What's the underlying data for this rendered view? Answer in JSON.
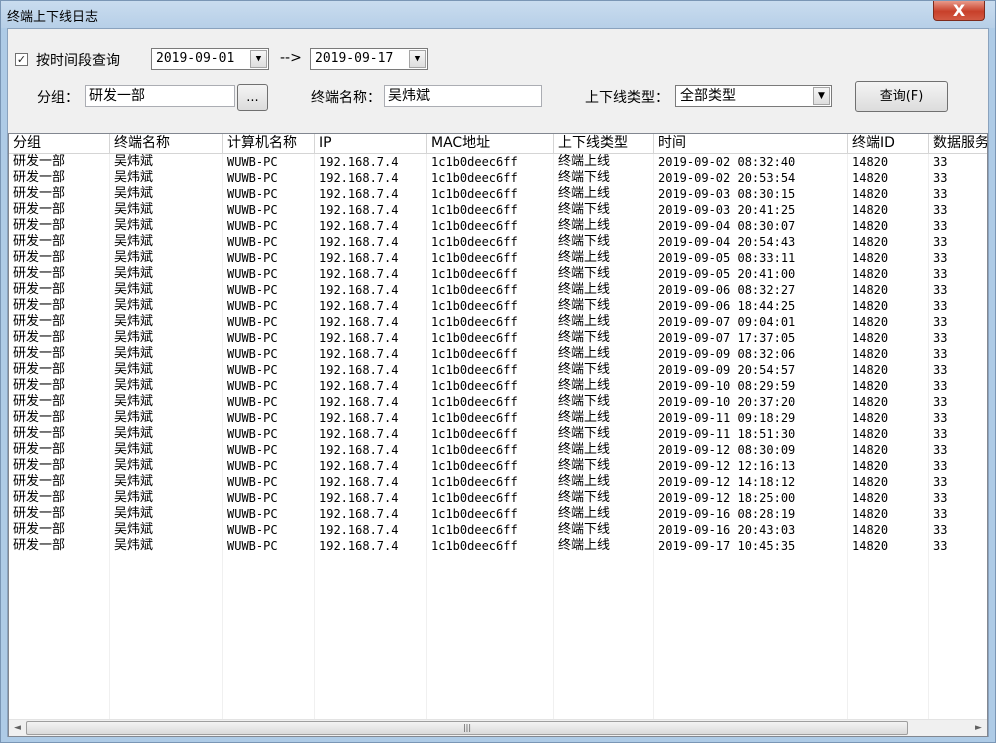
{
  "window": {
    "title": "终端上下线日志",
    "close_glyph": "X"
  },
  "filter": {
    "checkbox_label": "按时间段查询",
    "checkbox_mark": "✓",
    "date_from": "2019-09-01",
    "arrow_text": "-->",
    "date_to": "2019-09-17",
    "group_label": "分组：",
    "group_value": "研发一部",
    "browse_label": "...",
    "terminal_label": "终端名称：",
    "terminal_value": "吴炜斌",
    "type_label": "上下线类型：",
    "type_value": "全部类型",
    "query_button": "查询(F)"
  },
  "columns": [
    "分组",
    "终端名称",
    "计算机名称",
    "IP",
    "MAC地址",
    "上下线类型",
    "时间",
    "终端ID",
    "数据服务"
  ],
  "rows": [
    [
      "研发一部",
      "吴炜斌",
      "WUWB-PC",
      "192.168.7.4",
      "1c1b0deec6ff",
      "终端上线",
      "2019-09-02 08:32:40",
      "14820",
      "33"
    ],
    [
      "研发一部",
      "吴炜斌",
      "WUWB-PC",
      "192.168.7.4",
      "1c1b0deec6ff",
      "终端下线",
      "2019-09-02 20:53:54",
      "14820",
      "33"
    ],
    [
      "研发一部",
      "吴炜斌",
      "WUWB-PC",
      "192.168.7.4",
      "1c1b0deec6ff",
      "终端上线",
      "2019-09-03 08:30:15",
      "14820",
      "33"
    ],
    [
      "研发一部",
      "吴炜斌",
      "WUWB-PC",
      "192.168.7.4",
      "1c1b0deec6ff",
      "终端下线",
      "2019-09-03 20:41:25",
      "14820",
      "33"
    ],
    [
      "研发一部",
      "吴炜斌",
      "WUWB-PC",
      "192.168.7.4",
      "1c1b0deec6ff",
      "终端上线",
      "2019-09-04 08:30:07",
      "14820",
      "33"
    ],
    [
      "研发一部",
      "吴炜斌",
      "WUWB-PC",
      "192.168.7.4",
      "1c1b0deec6ff",
      "终端下线",
      "2019-09-04 20:54:43",
      "14820",
      "33"
    ],
    [
      "研发一部",
      "吴炜斌",
      "WUWB-PC",
      "192.168.7.4",
      "1c1b0deec6ff",
      "终端上线",
      "2019-09-05 08:33:11",
      "14820",
      "33"
    ],
    [
      "研发一部",
      "吴炜斌",
      "WUWB-PC",
      "192.168.7.4",
      "1c1b0deec6ff",
      "终端下线",
      "2019-09-05 20:41:00",
      "14820",
      "33"
    ],
    [
      "研发一部",
      "吴炜斌",
      "WUWB-PC",
      "192.168.7.4",
      "1c1b0deec6ff",
      "终端上线",
      "2019-09-06 08:32:27",
      "14820",
      "33"
    ],
    [
      "研发一部",
      "吴炜斌",
      "WUWB-PC",
      "192.168.7.4",
      "1c1b0deec6ff",
      "终端下线",
      "2019-09-06 18:44:25",
      "14820",
      "33"
    ],
    [
      "研发一部",
      "吴炜斌",
      "WUWB-PC",
      "192.168.7.4",
      "1c1b0deec6ff",
      "终端上线",
      "2019-09-07 09:04:01",
      "14820",
      "33"
    ],
    [
      "研发一部",
      "吴炜斌",
      "WUWB-PC",
      "192.168.7.4",
      "1c1b0deec6ff",
      "终端下线",
      "2019-09-07 17:37:05",
      "14820",
      "33"
    ],
    [
      "研发一部",
      "吴炜斌",
      "WUWB-PC",
      "192.168.7.4",
      "1c1b0deec6ff",
      "终端上线",
      "2019-09-09 08:32:06",
      "14820",
      "33"
    ],
    [
      "研发一部",
      "吴炜斌",
      "WUWB-PC",
      "192.168.7.4",
      "1c1b0deec6ff",
      "终端下线",
      "2019-09-09 20:54:57",
      "14820",
      "33"
    ],
    [
      "研发一部",
      "吴炜斌",
      "WUWB-PC",
      "192.168.7.4",
      "1c1b0deec6ff",
      "终端上线",
      "2019-09-10 08:29:59",
      "14820",
      "33"
    ],
    [
      "研发一部",
      "吴炜斌",
      "WUWB-PC",
      "192.168.7.4",
      "1c1b0deec6ff",
      "终端下线",
      "2019-09-10 20:37:20",
      "14820",
      "33"
    ],
    [
      "研发一部",
      "吴炜斌",
      "WUWB-PC",
      "192.168.7.4",
      "1c1b0deec6ff",
      "终端上线",
      "2019-09-11 09:18:29",
      "14820",
      "33"
    ],
    [
      "研发一部",
      "吴炜斌",
      "WUWB-PC",
      "192.168.7.4",
      "1c1b0deec6ff",
      "终端下线",
      "2019-09-11 18:51:30",
      "14820",
      "33"
    ],
    [
      "研发一部",
      "吴炜斌",
      "WUWB-PC",
      "192.168.7.4",
      "1c1b0deec6ff",
      "终端上线",
      "2019-09-12 08:30:09",
      "14820",
      "33"
    ],
    [
      "研发一部",
      "吴炜斌",
      "WUWB-PC",
      "192.168.7.4",
      "1c1b0deec6ff",
      "终端下线",
      "2019-09-12 12:16:13",
      "14820",
      "33"
    ],
    [
      "研发一部",
      "吴炜斌",
      "WUWB-PC",
      "192.168.7.4",
      "1c1b0deec6ff",
      "终端上线",
      "2019-09-12 14:18:12",
      "14820",
      "33"
    ],
    [
      "研发一部",
      "吴炜斌",
      "WUWB-PC",
      "192.168.7.4",
      "1c1b0deec6ff",
      "终端下线",
      "2019-09-12 18:25:00",
      "14820",
      "33"
    ],
    [
      "研发一部",
      "吴炜斌",
      "WUWB-PC",
      "192.168.7.4",
      "1c1b0deec6ff",
      "终端上线",
      "2019-09-16 08:28:19",
      "14820",
      "33"
    ],
    [
      "研发一部",
      "吴炜斌",
      "WUWB-PC",
      "192.168.7.4",
      "1c1b0deec6ff",
      "终端下线",
      "2019-09-16 20:43:03",
      "14820",
      "33"
    ],
    [
      "研发一部",
      "吴炜斌",
      "WUWB-PC",
      "192.168.7.4",
      "1c1b0deec6ff",
      "终端上线",
      "2019-09-17 10:45:35",
      "14820",
      "33"
    ]
  ],
  "scrollbar": {
    "left_glyph": "◄",
    "right_glyph": "►",
    "thumb_glyph": "|||"
  }
}
